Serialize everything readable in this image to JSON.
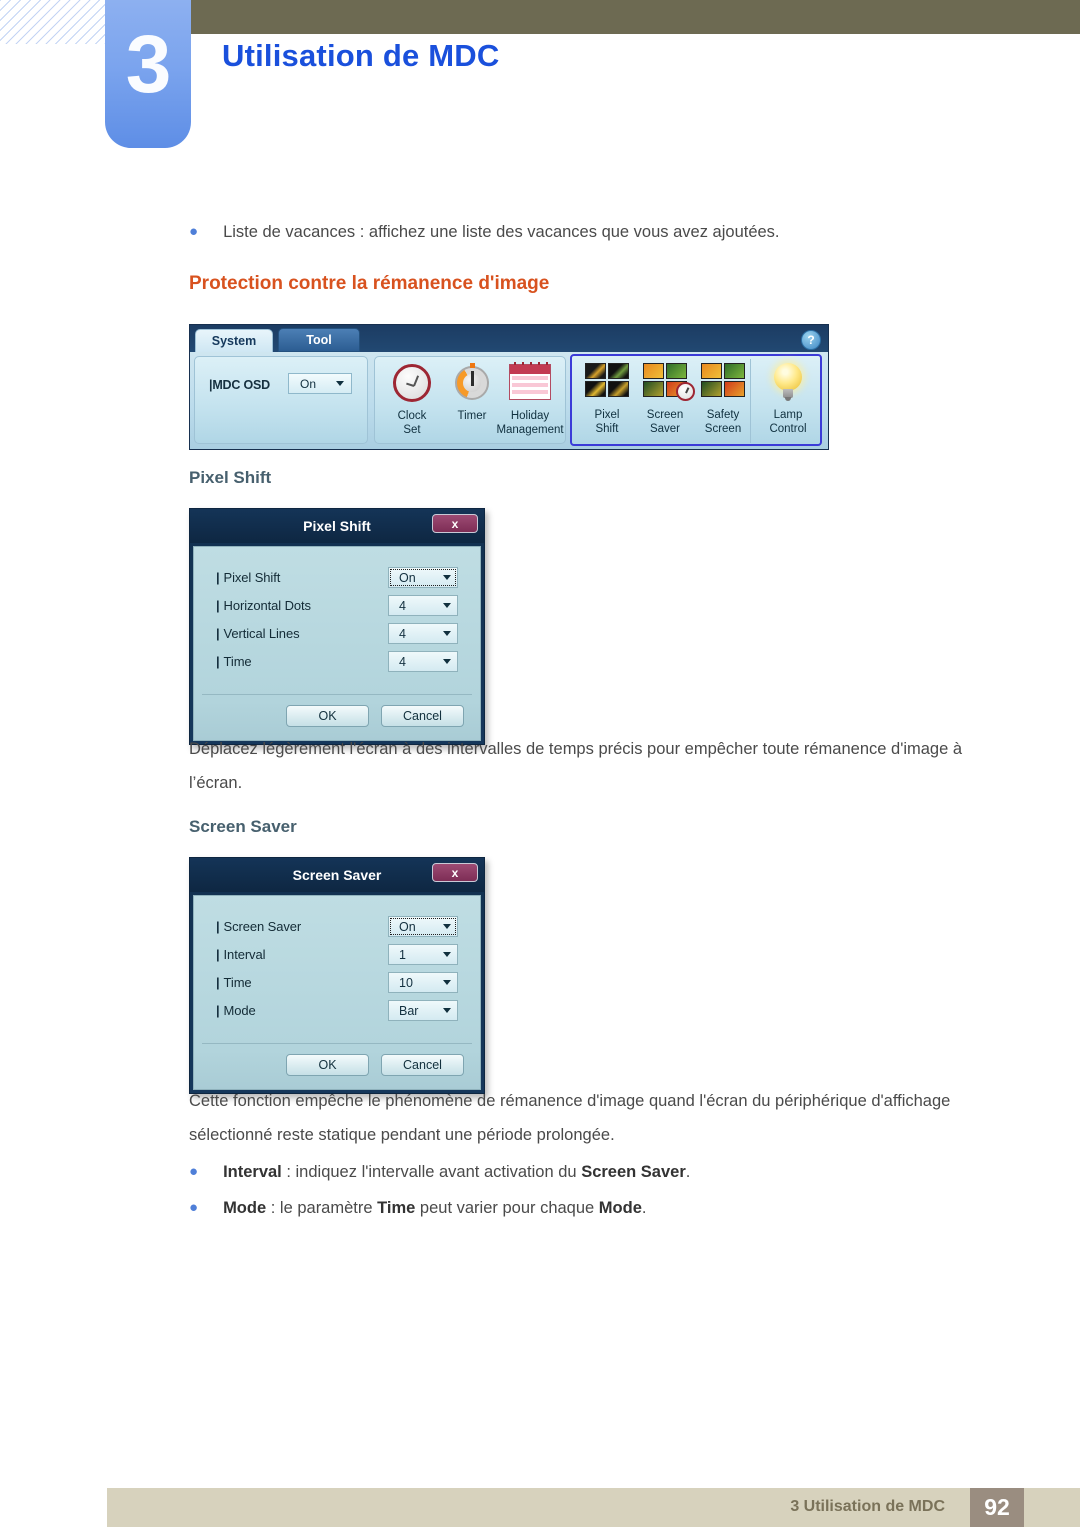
{
  "header": {
    "chapter_number": "3",
    "chapter_title": "Utilisation de MDC",
    "accent_blue": "#1a50dc",
    "tab_blue": "#7ba4ee",
    "olive": "#6d6a52"
  },
  "intro_bullet": {
    "marker": "●",
    "text": "Liste de vacances : affichez une liste des vacances que vous avez ajoutées."
  },
  "section_heading": "Protection contre la rémanence d'image",
  "toolbar": {
    "tabs": [
      {
        "label": "System",
        "active": true
      },
      {
        "label": "Tool",
        "active": false
      }
    ],
    "help_label": "?",
    "osd": {
      "label": "MDC OSD",
      "value": "On"
    },
    "tiles": [
      {
        "name": "clock-set",
        "line1": "Clock",
        "line2": "Set"
      },
      {
        "name": "timer",
        "line1": "Timer",
        "line2": ""
      },
      {
        "name": "holiday-management",
        "line1": "Holiday",
        "line2": "Management"
      },
      {
        "name": "pixel-shift",
        "line1": "Pixel",
        "line2": "Shift"
      },
      {
        "name": "screen-saver",
        "line1": "Screen",
        "line2": "Saver"
      },
      {
        "name": "safety-screen",
        "line1": "Safety",
        "line2": "Screen"
      },
      {
        "name": "lamp-control",
        "line1": "Lamp",
        "line2": "Control"
      }
    ]
  },
  "pixel_shift": {
    "heading": "Pixel Shift",
    "dialog": {
      "title": "Pixel Shift",
      "close_label": "x",
      "rows": [
        {
          "label": "Pixel Shift",
          "value": "On",
          "focused": true
        },
        {
          "label": "Horizontal Dots",
          "value": "4",
          "focused": false
        },
        {
          "label": "Vertical Lines",
          "value": "4",
          "focused": false
        },
        {
          "label": "Time",
          "value": "4",
          "focused": false
        }
      ],
      "ok_label": "OK",
      "cancel_label": "Cancel"
    },
    "description": "Déplacez légèrement l'écran à des intervalles de temps précis pour empêcher toute rémanence d'image à l’écran."
  },
  "screen_saver": {
    "heading": "Screen Saver",
    "dialog": {
      "title": "Screen Saver",
      "close_label": "x",
      "rows": [
        {
          "label": "Screen Saver",
          "value": "On",
          "focused": true
        },
        {
          "label": "Interval",
          "value": "1",
          "focused": false
        },
        {
          "label": "Time",
          "value": "10",
          "focused": false
        },
        {
          "label": "Mode",
          "value": "Bar",
          "focused": false
        }
      ],
      "ok_label": "OK",
      "cancel_label": "Cancel"
    },
    "description": "Cette fonction empêche le phénomène de rémanence d'image quand l'écran du périphérique d'affichage sélectionné reste statique pendant une période prolongée.",
    "bullets": [
      {
        "marker": "●",
        "strong1": "Interval",
        "mid": " : indiquez l'intervalle avant activation du ",
        "strong2": "Screen Saver",
        "tail": "."
      },
      {
        "marker": "●",
        "strong1": "Mode",
        "mid": " : le paramètre ",
        "strong2": "Time",
        "tail": " peut varier pour chaque ",
        "strong3": "Mode",
        "tail2": "."
      }
    ]
  },
  "footer": {
    "text": "3 Utilisation de MDC",
    "page": "92"
  }
}
